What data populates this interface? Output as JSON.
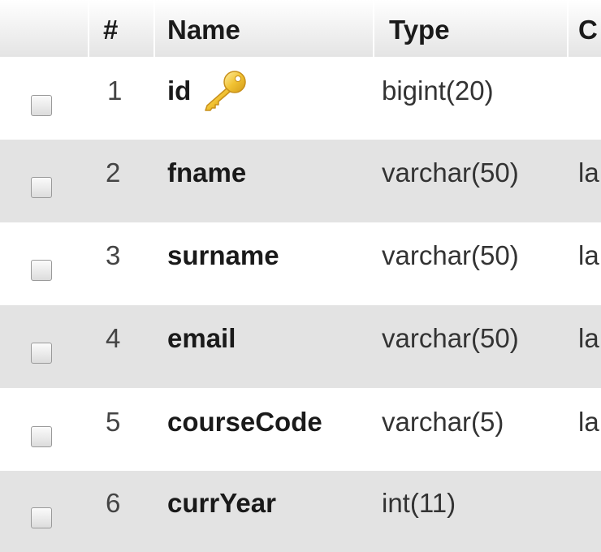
{
  "header": {
    "select_col": "",
    "num": "#",
    "name": "Name",
    "type": "Type",
    "collation": "C"
  },
  "rows": [
    {
      "num": "1",
      "name": "id",
      "type": "bigint(20)",
      "collation": "",
      "primary_key_icon": "key-icon"
    },
    {
      "num": "2",
      "name": "fname",
      "type": "varchar(50)",
      "collation": "la"
    },
    {
      "num": "3",
      "name": "surname",
      "type": "varchar(50)",
      "collation": "la"
    },
    {
      "num": "4",
      "name": "email",
      "type": "varchar(50)",
      "collation": "la"
    },
    {
      "num": "5",
      "name": "courseCode",
      "type": "varchar(5)",
      "collation": "la"
    },
    {
      "num": "6",
      "name": "currYear",
      "type": "int(11)",
      "collation": ""
    }
  ]
}
